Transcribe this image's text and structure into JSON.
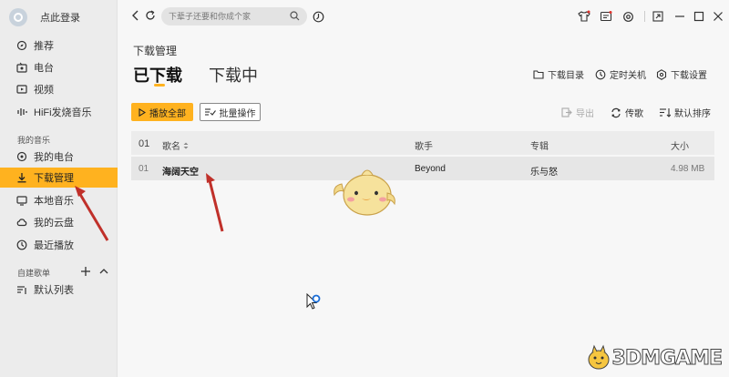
{
  "sidebar": {
    "profile": {
      "login_label": "点此登录"
    },
    "items": [
      {
        "label": "推荐",
        "icon": "recommend-icon"
      },
      {
        "label": "电台",
        "icon": "radio-icon"
      },
      {
        "label": "视频",
        "icon": "video-icon"
      },
      {
        "label": "HiFi发烧音乐",
        "icon": "hifi-icon"
      }
    ],
    "my_music_label": "我的音乐",
    "my_items": [
      {
        "label": "我的电台",
        "icon": "my-radio-icon"
      },
      {
        "label": "下载管理",
        "icon": "download-icon",
        "active": true
      },
      {
        "label": "本地音乐",
        "icon": "local-music-icon"
      },
      {
        "label": "我的云盘",
        "icon": "cloud-icon"
      },
      {
        "label": "最近播放",
        "icon": "history-icon"
      }
    ],
    "playlist_label": "自建歌单",
    "playlist_items": [
      {
        "label": "默认列表",
        "icon": "playlist-icon"
      }
    ]
  },
  "search": {
    "placeholder": "下辈子还要和你成个家"
  },
  "main": {
    "page_title": "下载管理",
    "tabs": [
      {
        "label": "已下载",
        "active": true
      },
      {
        "label": "下载中",
        "active": false
      }
    ],
    "top_actions": [
      {
        "label": "下载目录",
        "icon": "folder-icon"
      },
      {
        "label": "定时关机",
        "icon": "timer-icon"
      },
      {
        "label": "下载设置",
        "icon": "settings-icon"
      }
    ],
    "play_all_label": "播放全部",
    "batch_label": "批量操作",
    "right_actions": [
      {
        "label": "导出",
        "icon": "export-icon",
        "disabled": true
      },
      {
        "label": "传歌",
        "icon": "transfer-icon",
        "disabled": false
      },
      {
        "label": "默认排序",
        "icon": "sort-icon",
        "disabled": false
      }
    ],
    "table": {
      "headers": {
        "index": "01",
        "name": "歌名",
        "artist": "歌手",
        "album": "专辑",
        "size": "大小"
      },
      "rows": [
        {
          "index": "01",
          "name": "海阔天空",
          "artist": "Beyond",
          "album": "乐与怒",
          "size": "4.98 MB"
        }
      ]
    }
  },
  "watermark": {
    "text": "3DMGAME"
  },
  "colors": {
    "accent": "#ffb21f",
    "arrow": "#c0302a"
  }
}
